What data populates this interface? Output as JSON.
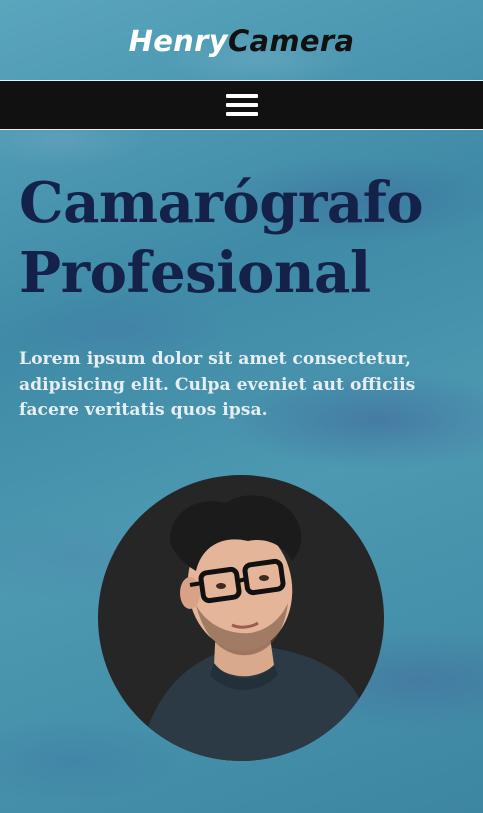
{
  "header": {
    "logo_part1": "Henry",
    "logo_part2": "Camera"
  },
  "nav": {
    "menu_icon": "hamburger-menu-icon"
  },
  "hero": {
    "title_line1": "Camarógrafo",
    "title_line2": "Profesional",
    "text": "Lorem ipsum dolor sit amet consectetur, adipisicing elit. Culpa eveniet aut officiis facere veritatis quos ipsa.",
    "photo_icon": "person-portrait"
  },
  "colors": {
    "background": "#4a96ad",
    "navbar": "#111111",
    "title": "#14224a",
    "text": "#e6eef2",
    "logo_primary": "#ffffff",
    "logo_secondary": "#111111"
  }
}
